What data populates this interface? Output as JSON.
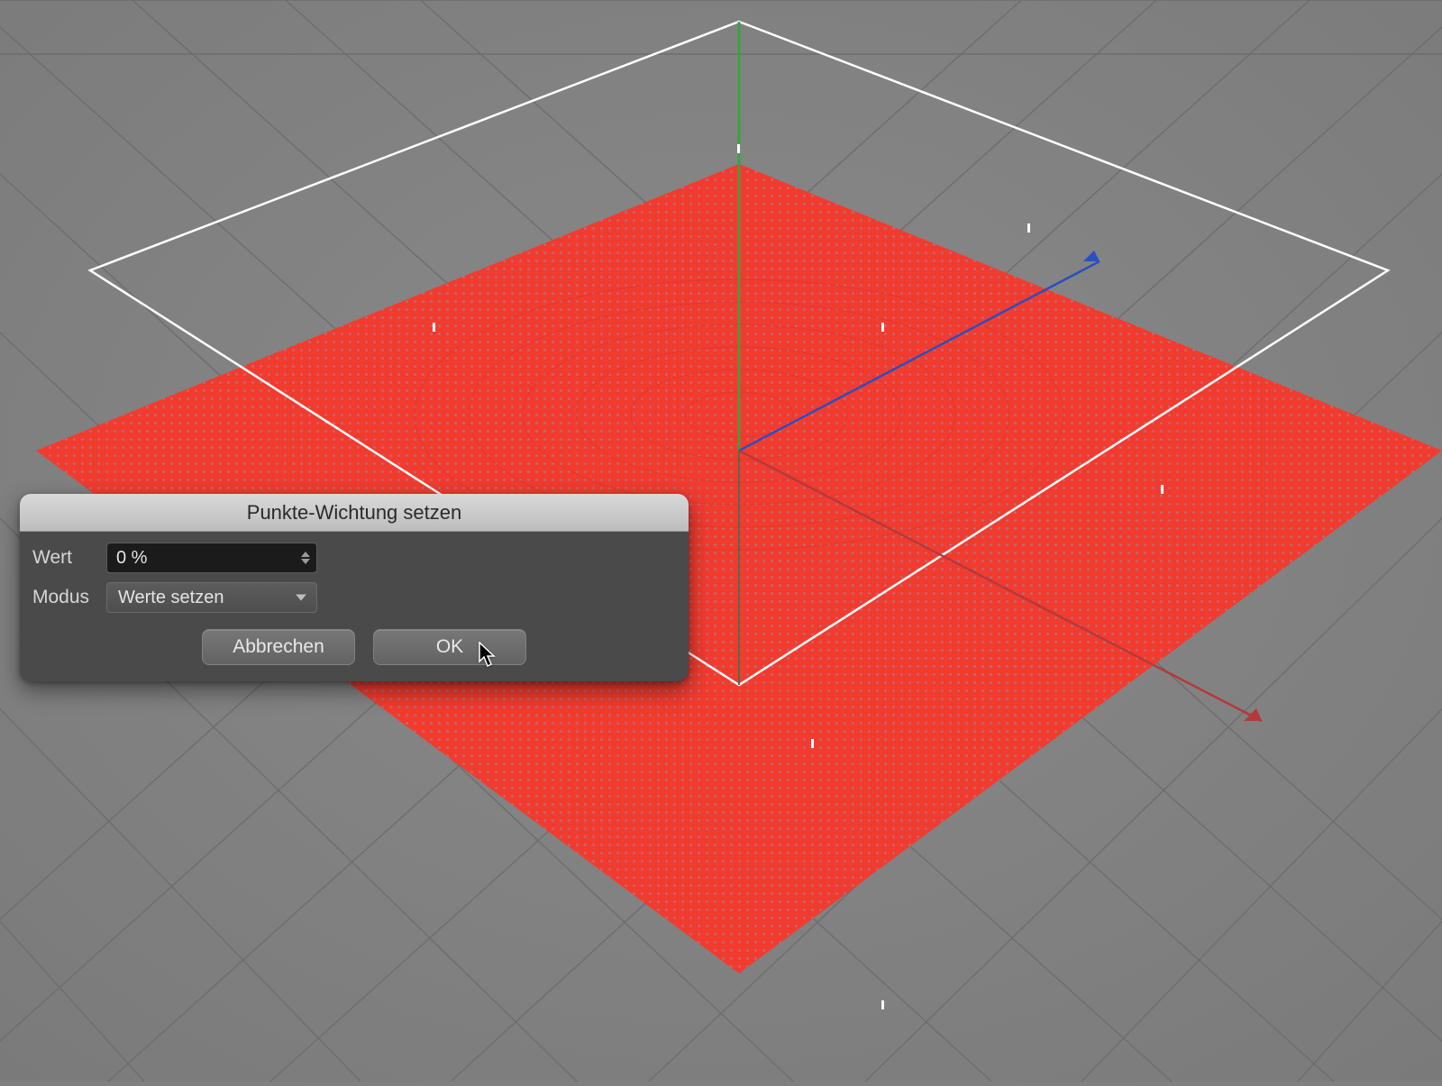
{
  "dialog": {
    "title": "Punkte-Wichtung setzen",
    "fields": {
      "wert_label": "Wert",
      "wert_value": "0 %",
      "modus_label": "Modus",
      "modus_value": "Werte setzen"
    },
    "buttons": {
      "cancel": "Abbrechen",
      "ok": "OK"
    }
  },
  "scene": {
    "axis_colors": {
      "x": "#b33a3a",
      "y": "#2fa83a",
      "z": "#2a4fc0"
    },
    "mesh_color": "#f23b2f",
    "grid_color": "#6d6d6d",
    "bbox_color": "#ffffff",
    "point_color": "#7aa0d0"
  }
}
